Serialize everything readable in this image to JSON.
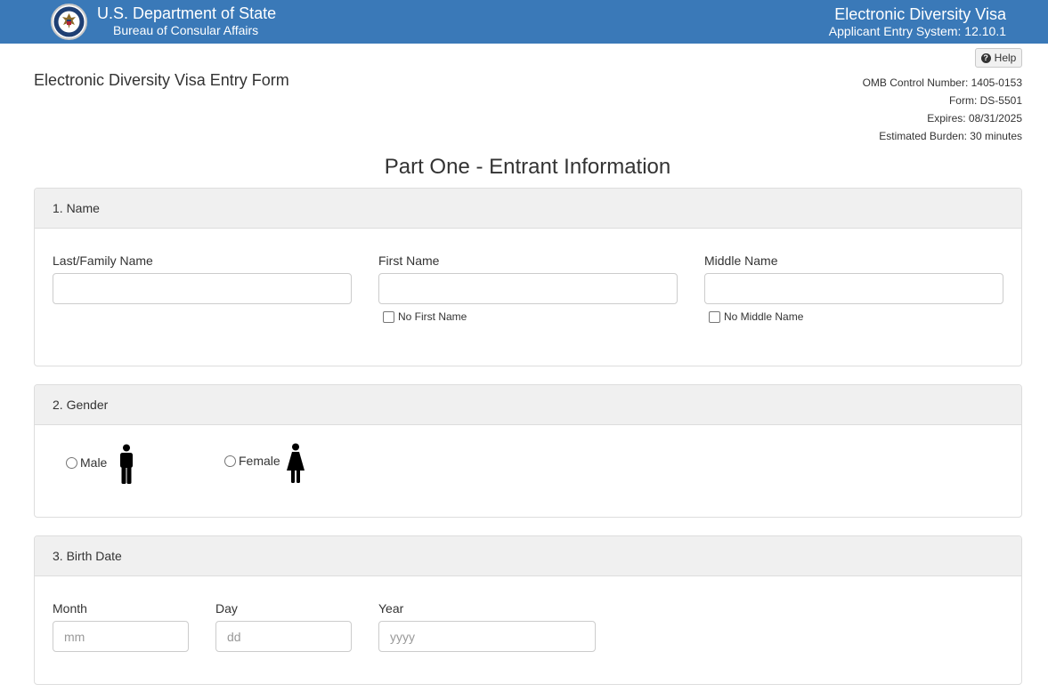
{
  "header": {
    "department": "U.S. Department of State",
    "bureau": "Bureau of Consular Affairs",
    "system_title": "Electronic Diversity Visa",
    "system_version": "Applicant Entry System: 12.10.1",
    "seal_icon": "department-seal-icon",
    "bar_color": "#3a79b8"
  },
  "help": {
    "label": "Help",
    "icon": "question-circle-icon"
  },
  "form": {
    "title": "Electronic Diversity Visa Entry Form",
    "omb_control": "OMB Control Number: 1405-0153",
    "form_number": "Form: DS-5501",
    "expires": "Expires: 08/31/2025",
    "burden": "Estimated Burden: 30 minutes"
  },
  "part_title": "Part One - Entrant Information",
  "sections": {
    "name": {
      "heading": "1. Name",
      "last_label": "Last/Family Name",
      "last_value": "",
      "first_label": "First Name",
      "first_value": "",
      "middle_label": "Middle Name",
      "middle_value": "",
      "no_first_label": "No First Name",
      "no_middle_label": "No Middle Name"
    },
    "gender": {
      "heading": "2. Gender",
      "male_label": "Male",
      "female_label": "Female",
      "male_icon": "male-figure-icon",
      "female_icon": "female-figure-icon"
    },
    "birth": {
      "heading": "3. Birth Date",
      "month_label": "Month",
      "month_placeholder": "mm",
      "day_label": "Day",
      "day_placeholder": "dd",
      "year_label": "Year",
      "year_placeholder": "yyyy"
    }
  }
}
